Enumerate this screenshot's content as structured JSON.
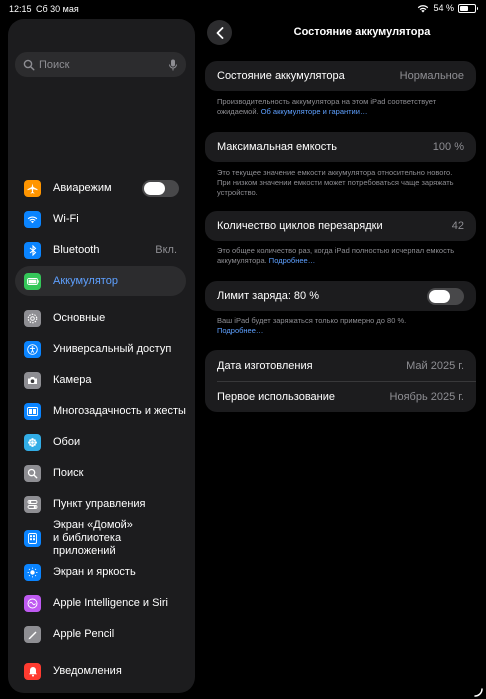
{
  "status_bar": {
    "time": "12:15",
    "date": "Сб 30 мая",
    "battery_percent": "54 %",
    "battery_level": 0.54
  },
  "sidebar": {
    "search_placeholder": "Поиск",
    "items": [
      {
        "label": "Авиарежим",
        "icon": "airplane-icon",
        "icon_color": "#ff9500",
        "toggle": false
      },
      {
        "label": "Wi-Fi",
        "icon": "wifi-icon",
        "icon_color": "#0a84ff"
      },
      {
        "label": "Bluetooth",
        "icon": "bluetooth-icon",
        "icon_color": "#0a84ff",
        "value": "Вкл."
      },
      {
        "label": "Аккумулятор",
        "icon": "battery-icon",
        "icon_color": "#34c759",
        "active": true
      },
      {
        "label": "Основные",
        "icon": "gear-icon",
        "icon_color": "#8e8e93"
      },
      {
        "label": "Универсальный доступ",
        "icon": "accessibility-icon",
        "icon_color": "#0a84ff"
      },
      {
        "label": "Камера",
        "icon": "camera-icon",
        "icon_color": "#8e8e93"
      },
      {
        "label": "Многозадачность и жесты",
        "icon": "multitasking-icon",
        "icon_color": "#0a84ff"
      },
      {
        "label": "Обои",
        "icon": "wallpaper-icon",
        "icon_color": "#32ade6"
      },
      {
        "label": "Поиск",
        "icon": "search-icon",
        "icon_color": "#8e8e93"
      },
      {
        "label": "Пункт управления",
        "icon": "control-center-icon",
        "icon_color": "#8e8e93"
      },
      {
        "label": "Экран «Домой»\nи библиотека приложений",
        "icon": "home-screen-icon",
        "icon_color": "#0a84ff"
      },
      {
        "label": "Экран и яркость",
        "icon": "brightness-icon",
        "icon_color": "#0a84ff"
      },
      {
        "label": "Apple Intelligence и Siri",
        "icon": "siri-icon",
        "icon_color": "#bf5af2"
      },
      {
        "label": "Apple Pencil",
        "icon": "pencil-icon",
        "icon_color": "#8e8e93"
      },
      {
        "label": "Уведомления",
        "icon": "bell-icon",
        "icon_color": "#ff3b30"
      }
    ]
  },
  "detail": {
    "title": "Состояние аккумулятора",
    "health": {
      "label": "Состояние аккумулятора",
      "value": "Нормальное"
    },
    "health_footer": "Производительность аккумулятора на этом iPad соответствует ожидаемой.",
    "health_footer_link": "Об аккумуляторе и гарантии…",
    "max_capacity": {
      "label": "Максимальная емкость",
      "value": "100 %"
    },
    "max_capacity_footer": "Это текущее значение емкости аккумулятора относительно нового. При низком значении емкости может потребоваться чаще заряжать устройство.",
    "cycle_count": {
      "label": "Количество циклов перезарядки",
      "value": "42"
    },
    "cycle_count_footer": "Это общее количество раз, когда iPad полностью исчерпал емкость аккумулятора.",
    "cycle_count_footer_link": "Подробнее…",
    "charge_limit": {
      "label": "Лимит заряда: 80 %",
      "enabled": false
    },
    "charge_limit_footer": "Ваш iPad будет заряжаться только примерно до 80 %.",
    "charge_limit_footer_link": "Подробнее…",
    "manufacture_date": {
      "label": "Дата изготовления",
      "value": "Май 2025 г."
    },
    "first_use": {
      "label": "Первое использование",
      "value": "Ноябрь 2025 г."
    }
  }
}
